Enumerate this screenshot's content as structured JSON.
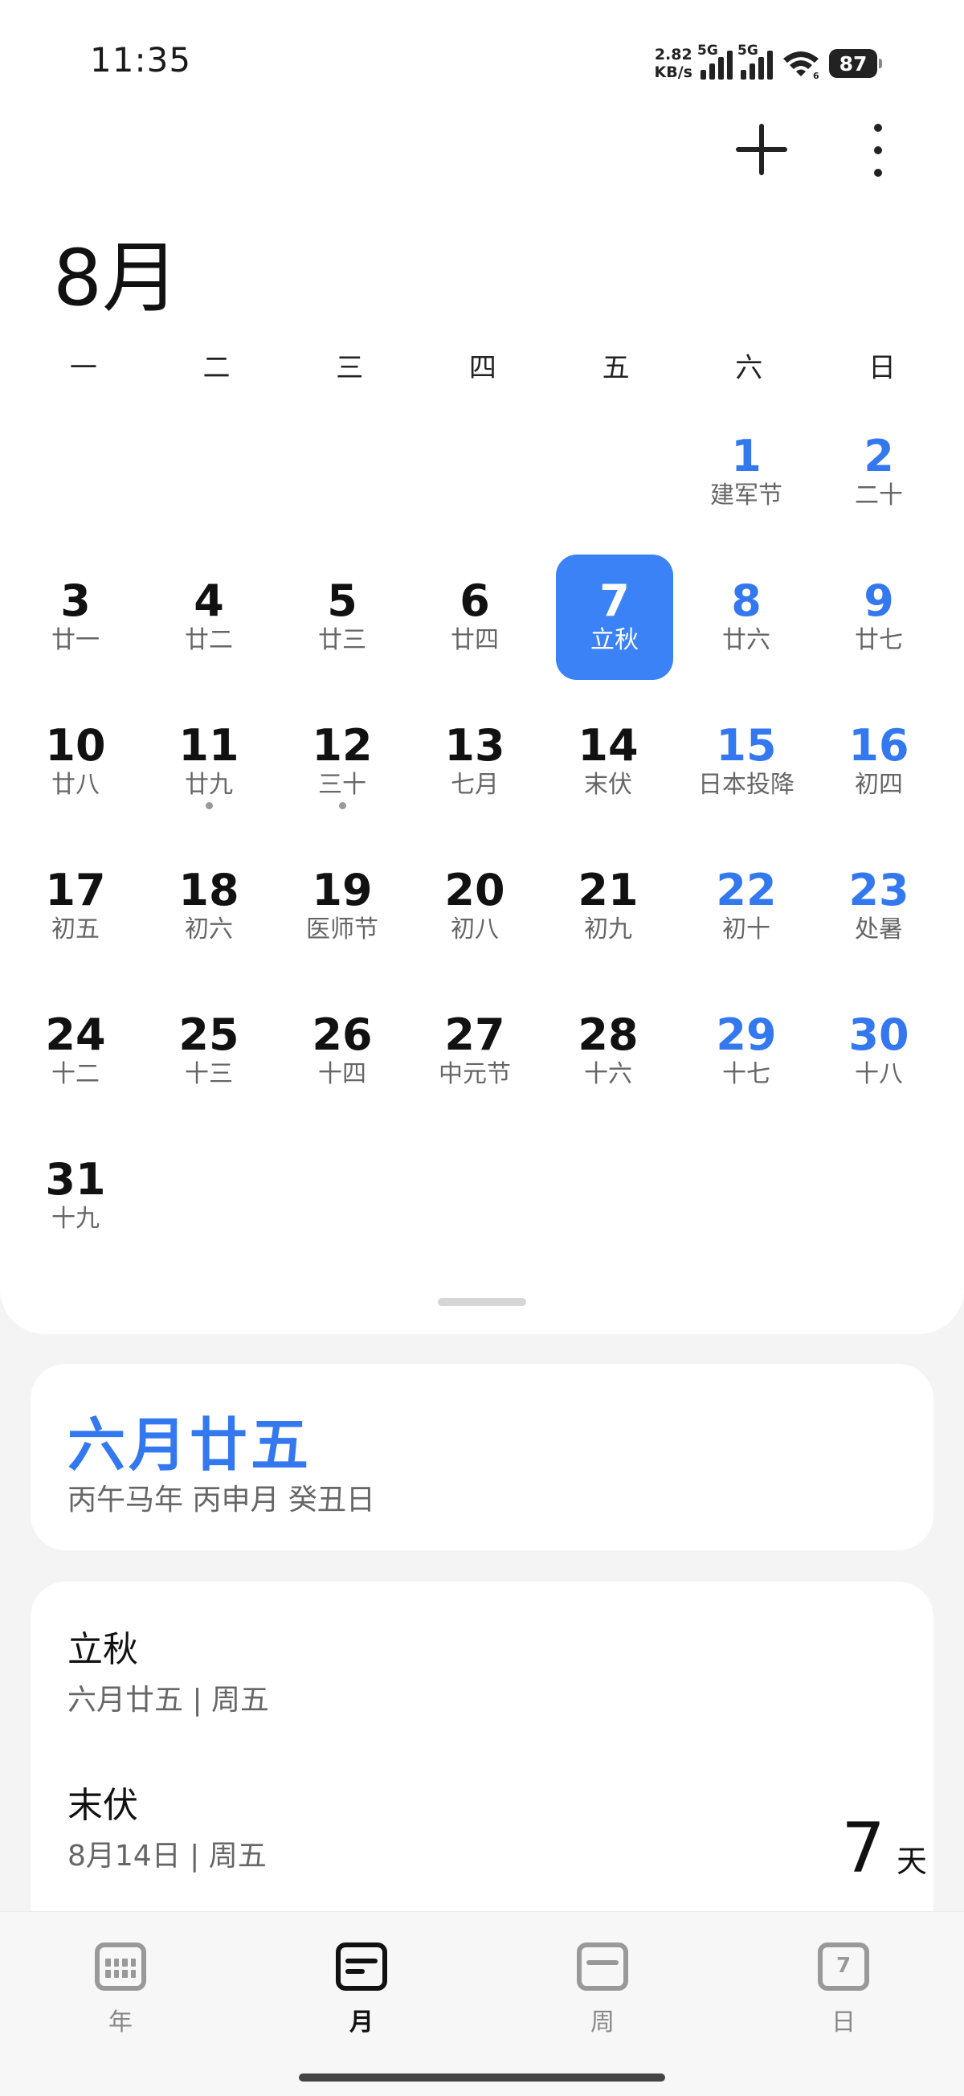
{
  "status": {
    "time": "11:35",
    "net_speed_value": "2.82",
    "net_speed_unit": "KB/s",
    "sim1_tag": "5G",
    "sim2_tag": "5G",
    "wifi_badge": "6",
    "battery": "87"
  },
  "toolbar": {
    "add_icon": "plus-icon",
    "more_icon": "more-vertical-icon"
  },
  "calendar": {
    "month_title": "8月",
    "weekdays": [
      "一",
      "二",
      "三",
      "四",
      "五",
      "六",
      "日"
    ],
    "accent_color": "#3478f0",
    "selected_color": "#3b82f6",
    "days": [
      {
        "day": "1",
        "lunar": "建军节"
      },
      {
        "day": "2",
        "lunar": "二十"
      },
      {
        "day": "3",
        "lunar": "廿一"
      },
      {
        "day": "4",
        "lunar": "廿二"
      },
      {
        "day": "5",
        "lunar": "廿三"
      },
      {
        "day": "6",
        "lunar": "廿四"
      },
      {
        "day": "7",
        "lunar": "立秋"
      },
      {
        "day": "8",
        "lunar": "廿六"
      },
      {
        "day": "9",
        "lunar": "廿七"
      },
      {
        "day": "10",
        "lunar": "廿八"
      },
      {
        "day": "11",
        "lunar": "廿九"
      },
      {
        "day": "12",
        "lunar": "三十"
      },
      {
        "day": "13",
        "lunar": "七月"
      },
      {
        "day": "14",
        "lunar": "末伏"
      },
      {
        "day": "15",
        "lunar": "日本投降"
      },
      {
        "day": "16",
        "lunar": "初四"
      },
      {
        "day": "17",
        "lunar": "初五"
      },
      {
        "day": "18",
        "lunar": "初六"
      },
      {
        "day": "19",
        "lunar": "医师节"
      },
      {
        "day": "20",
        "lunar": "初八"
      },
      {
        "day": "21",
        "lunar": "初九"
      },
      {
        "day": "22",
        "lunar": "初十"
      },
      {
        "day": "23",
        "lunar": "处暑"
      },
      {
        "day": "24",
        "lunar": "十二"
      },
      {
        "day": "25",
        "lunar": "十三"
      },
      {
        "day": "26",
        "lunar": "十四"
      },
      {
        "day": "27",
        "lunar": "中元节"
      },
      {
        "day": "28",
        "lunar": "十六"
      },
      {
        "day": "29",
        "lunar": "十七"
      },
      {
        "day": "30",
        "lunar": "十八"
      },
      {
        "day": "31",
        "lunar": "十九"
      }
    ]
  },
  "lunar_card": {
    "date": "六月廿五",
    "ganzhi": "丙午马年 丙申月 癸丑日"
  },
  "events": [
    {
      "title": "立秋",
      "subtitle": "六月廿五 | 周五"
    },
    {
      "title": "末伏",
      "subtitle": "8月14日 | 周五",
      "countdown": "7",
      "countdown_unit": "天"
    }
  ],
  "bottom_nav": {
    "items": [
      {
        "label": "年",
        "icon": "year-grid-icon"
      },
      {
        "label": "月",
        "icon": "month-list-icon"
      },
      {
        "label": "周",
        "icon": "week-bar-icon"
      },
      {
        "label": "日",
        "icon": "day-number-icon",
        "icon_text": "7"
      }
    ]
  }
}
